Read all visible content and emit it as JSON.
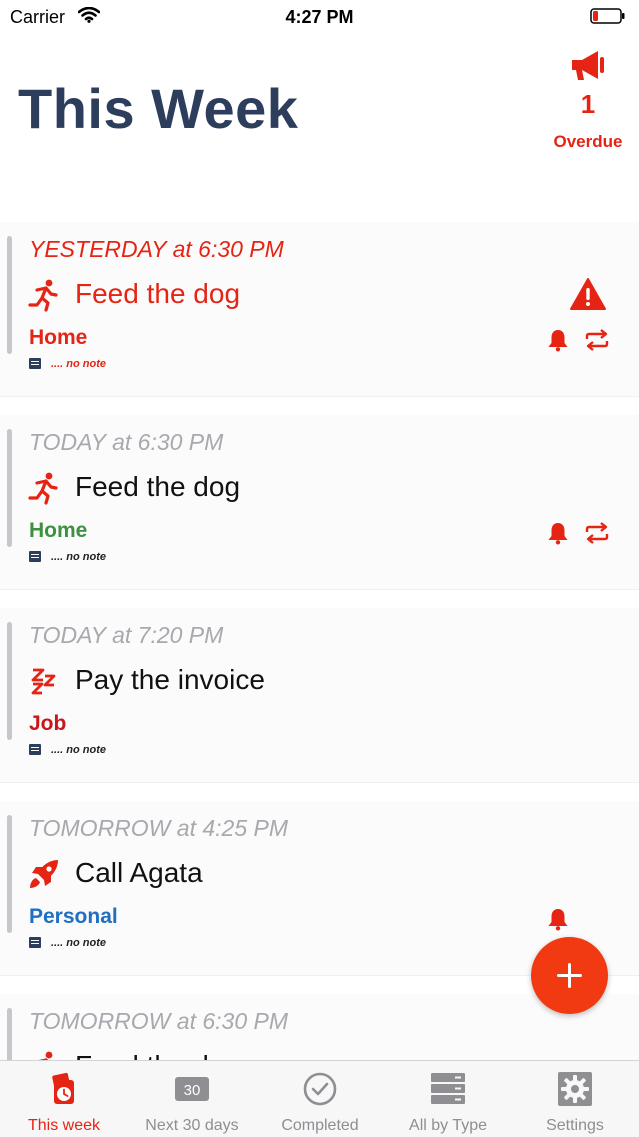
{
  "status_bar": {
    "carrier": "Carrier",
    "time": "4:27 PM"
  },
  "header": {
    "title": "This Week",
    "overdue_count": "1",
    "overdue_label": "Overdue"
  },
  "colors": {
    "accent": "#e52414",
    "title": "#2c3e5c",
    "home_green": "#3d9140",
    "job_red": "#c8161b",
    "personal_blue": "#1f6fc2"
  },
  "tasks": [
    {
      "date": "YESTERDAY at 6:30 PM",
      "title": "Feed the dog",
      "icon": "running-icon",
      "category": "Home",
      "note": ".... no note",
      "overdue": true
    },
    {
      "date": "TODAY at 6:30 PM",
      "title": "Feed the dog",
      "icon": "running-icon",
      "category": "Home",
      "note": ".... no note",
      "overdue": false
    },
    {
      "date": "TODAY at 7:20 PM",
      "title": "Pay the invoice",
      "icon": "zzz-icon",
      "category": "Job",
      "note": ".... no note",
      "overdue": false
    },
    {
      "date": "TOMORROW at 4:25 PM",
      "title": "Call Agata",
      "icon": "rocket-icon",
      "category": "Personal",
      "note": ".... no note",
      "overdue": false
    },
    {
      "date": "TOMORROW at 6:30 PM",
      "title": "Feed the dog",
      "icon": "running-icon",
      "category": "",
      "note": "",
      "overdue": false
    }
  ],
  "tabs": [
    {
      "label": "This week",
      "icon": "calendar-clock-icon",
      "active": true
    },
    {
      "label": "Next 30 days",
      "icon": "calendar-30-icon",
      "badge": "30",
      "active": false
    },
    {
      "label": "Completed",
      "icon": "checkmark-circle-icon",
      "active": false
    },
    {
      "label": "All by Type",
      "icon": "server-stack-icon",
      "active": false
    },
    {
      "label": "Settings",
      "icon": "gear-icon",
      "active": false
    }
  ]
}
